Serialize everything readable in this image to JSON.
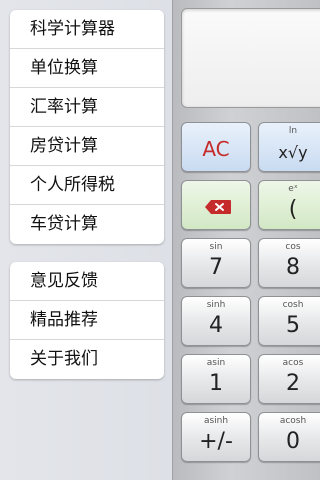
{
  "menu": {
    "group1": [
      {
        "label": "科学计算器"
      },
      {
        "label": "单位换算"
      },
      {
        "label": "汇率计算"
      },
      {
        "label": "房贷计算"
      },
      {
        "label": "个人所得税"
      },
      {
        "label": "车贷计算"
      }
    ],
    "group2": [
      {
        "label": "意见反馈"
      },
      {
        "label": "精品推荐"
      },
      {
        "label": "关于我们"
      }
    ]
  },
  "calculator": {
    "display_value": "",
    "keys": [
      {
        "sub": "",
        "main": "AC"
      },
      {
        "sub": "ln",
        "main": "x√y"
      },
      {
        "sub": "",
        "main": "",
        "icon": "backspace-icon"
      },
      {
        "sub": "eˣ",
        "main": "("
      },
      {
        "sub": "sin",
        "main": "7"
      },
      {
        "sub": "cos",
        "main": "8"
      },
      {
        "sub": "sinh",
        "main": "4"
      },
      {
        "sub": "cosh",
        "main": "5"
      },
      {
        "sub": "asin",
        "main": "1"
      },
      {
        "sub": "acos",
        "main": "2"
      },
      {
        "sub": "asinh",
        "main": "+/-"
      },
      {
        "sub": "acosh",
        "main": "0"
      }
    ]
  },
  "colors": {
    "ac_red": "#c62b2b",
    "key_blue": "#c9dbf1",
    "key_green": "#d2e8c4"
  }
}
